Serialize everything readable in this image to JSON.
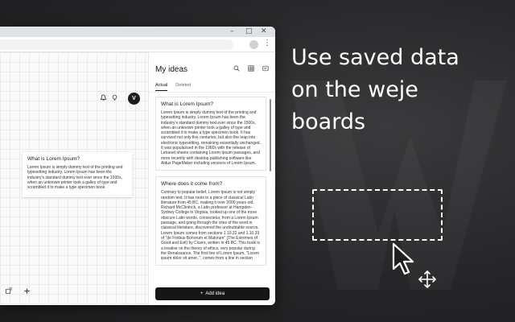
{
  "headline": {
    "line1": "Use saved data",
    "line2": "on the weje",
    "line3": "boards"
  },
  "browser": {
    "window_controls": {
      "minimize": "–",
      "maximize": "□",
      "close": "✕"
    },
    "toolbar_menu": "⋮"
  },
  "board": {
    "avatar_initial": "V",
    "icons": [
      "bell-icon",
      "lightbulb-icon"
    ],
    "card": {
      "title": "What is Lorem Ipsum?",
      "text": "Lorem Ipsum is simply dummy text of the printing and typesetting industry. Lorem Ipsum has been the industry's standard dummy text ever since the 1500s, when an unknown printer took a galley of type and scrambled it to make a type specimen book."
    },
    "bottom_icons": [
      "shape-icon",
      "plus-icon"
    ]
  },
  "panel": {
    "title": "My ideas",
    "tabs": [
      {
        "label": "Actual",
        "active": true
      },
      {
        "label": "Deleted",
        "active": false
      }
    ],
    "ideas": [
      {
        "title": "What is Lorem Ipsum?",
        "text": "Lorem Ipsum is simply dummy text of the printing and typesetting industry. Lorem Ipsum has been the industry's standard dummy text ever since the 1500s, when an unknown printer took a galley of type and scrambled it to make a type specimen book. It has survived not only five centuries, but also the leap into electronic typesetting, remaining essentially unchanged. It was popularised in the 1960s with the release of Letraset sheets containing Lorem Ipsum passages, and more recently with desktop publishing software like Aldus PageMaker including versions of Lorem Ipsum."
      },
      {
        "title": "Where does it come from?",
        "text": "Contrary to popular belief, Lorem Ipsum is not simply random text. It has roots in a piece of classical Latin literature from 45 BC, making it over 2000 years old. Richard McClintock, a Latin professor at Hampden-Sydney College in Virginia, looked up one of the more obscure Latin words, consectetur, from a Lorem Ipsum passage, and going through the cites of the word in classical literature, discovered the undoubtable source. Lorem Ipsum comes from sections 1.10.32 and 1.10.33 of \"de Finibus Bonorum et Malorum\" (The Extremes of Good and Evil) by Cicero, written in 45 BC. This book is a treatise on the theory of ethics, very popular during the Renaissance. The first line of Lorem Ipsum, \"Lorem ipsum dolor sit amet..\", comes from a line in section"
      }
    ],
    "add_button": {
      "icon": "+",
      "label": "Add idea"
    }
  },
  "colors": {
    "background": "#262628",
    "accent": "#151515",
    "headline": "#ffffff"
  }
}
